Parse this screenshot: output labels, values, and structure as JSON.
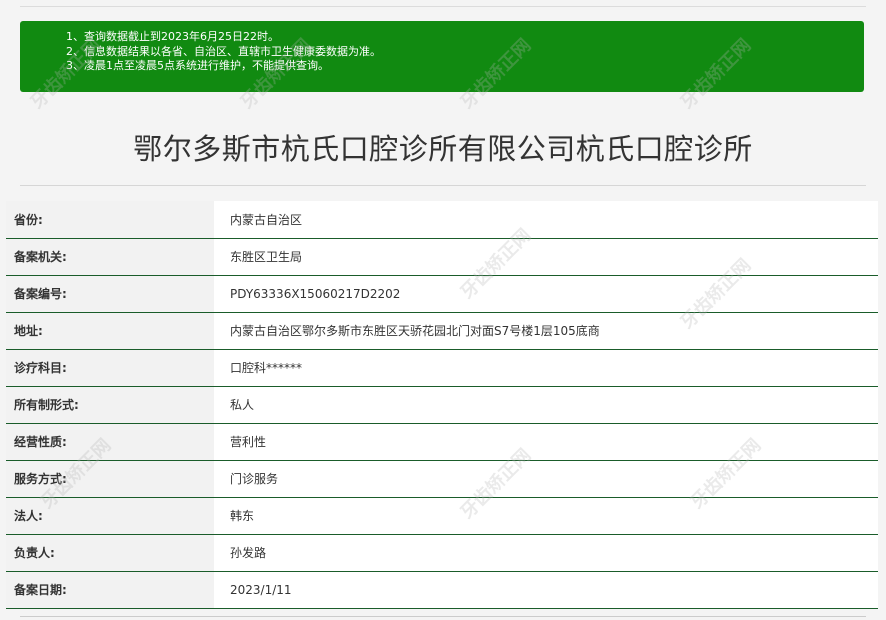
{
  "notice": {
    "lines": [
      "1、查询数据截止到2023年6月25日22时。",
      "2、信息数据结果以各省、自治区、直辖市卫生健康委数据为准。",
      "3、凌晨1点至凌晨5点系统进行维护，不能提供查询。"
    ],
    "background_color": "#118a11"
  },
  "title": "鄂尔多斯市杭氏口腔诊所有限公司杭氏口腔诊所",
  "rows": [
    {
      "label": "省份:",
      "value": "内蒙古自治区"
    },
    {
      "label": "备案机关:",
      "value": "东胜区卫生局"
    },
    {
      "label": "备案编号:",
      "value": "PDY63336X15060217D2202"
    },
    {
      "label": "地址:",
      "value": "内蒙古自治区鄂尔多斯市东胜区天骄花园北门对面S7号楼1层105底商"
    },
    {
      "label": "诊疗科目:",
      "value": "口腔科******"
    },
    {
      "label": "所有制形式:",
      "value": "私人"
    },
    {
      "label": "经营性质:",
      "value": "营利性"
    },
    {
      "label": "服务方式:",
      "value": "门诊服务"
    },
    {
      "label": "法人:",
      "value": "韩东"
    },
    {
      "label": "负责人:",
      "value": "孙发路"
    },
    {
      "label": "备案日期:",
      "value": "2023/1/11"
    }
  ],
  "watermark": "牙齿矫正网"
}
